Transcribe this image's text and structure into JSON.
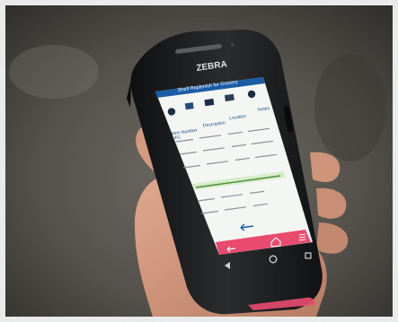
{
  "photo": {
    "device_brand": "ZEBRA",
    "app_title": "Shelf Replenish for Grocery",
    "toolbar_icons": [
      "globe-icon",
      "truck-icon",
      "calendar-icon",
      "chart-icon",
      "people-icon"
    ],
    "columns": [
      "Item Number",
      "Description",
      "Location",
      "Notes"
    ],
    "column_sub": [
      "UPC",
      "",
      "",
      ""
    ],
    "nav_icons": [
      "back-arrow-icon",
      "home-icon",
      "menu-icon"
    ],
    "system_nav_icons": [
      "back-triangle-icon",
      "home-circle-icon",
      "recents-square-icon"
    ],
    "colors": {
      "background": "#e9ebea",
      "case": "#1d1f21",
      "screen": "#f4f6f4",
      "accent_pink": "#e84b6e",
      "header_blue": "#1a5da6",
      "skin": "#c98f76"
    }
  }
}
